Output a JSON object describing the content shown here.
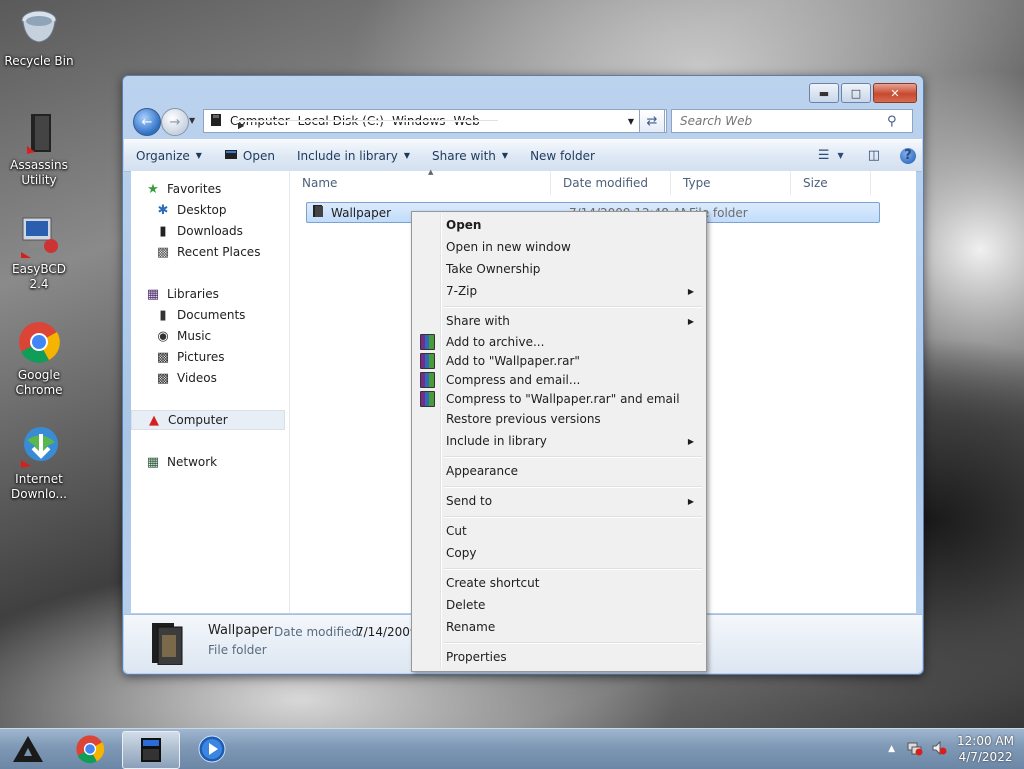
{
  "desktop": {
    "icons": [
      {
        "label": "Recycle Bin"
      },
      {
        "label": "Assassins Utility"
      },
      {
        "label": "EasyBCD 2.4"
      },
      {
        "label": "Google Chrome"
      },
      {
        "label": "Internet Downlo..."
      }
    ]
  },
  "window": {
    "address": {
      "crumbs": [
        "Computer",
        "Local Disk (C:)",
        "Windows",
        "Web"
      ]
    },
    "search": {
      "placeholder": "Search Web"
    },
    "toolbar": {
      "organize": "Organize",
      "open": "Open",
      "include_in_library": "Include in library",
      "share_with": "Share with",
      "new_folder": "New folder"
    },
    "nav": {
      "favorites": "Favorites",
      "desktop": "Desktop",
      "downloads": "Downloads",
      "recent_places": "Recent Places",
      "libraries": "Libraries",
      "documents": "Documents",
      "music": "Music",
      "pictures": "Pictures",
      "videos": "Videos",
      "computer": "Computer",
      "network": "Network"
    },
    "columns": {
      "name": "Name",
      "date_modified": "Date modified",
      "type": "Type",
      "size": "Size"
    },
    "files": [
      {
        "name": "Wallpaper",
        "date": "7/14/2009 12:48 AM",
        "type": "File folder",
        "size": ""
      }
    ],
    "details": {
      "name": "Wallpaper",
      "date_label": "Date modified:",
      "date_value": "7/14/2009",
      "type": "File folder"
    }
  },
  "context_menu": {
    "open": "Open",
    "open_new_window": "Open in new window",
    "take_ownership": "Take Ownership",
    "seven_zip": "7-Zip",
    "share_with": "Share with",
    "add_to_archive": "Add to archive...",
    "add_to_rar": "Add to \"Wallpaper.rar\"",
    "compress_email": "Compress and email...",
    "compress_rar_email": "Compress to \"Wallpaper.rar\" and email",
    "restore_previous": "Restore previous versions",
    "include_in_library": "Include in library",
    "appearance": "Appearance",
    "send_to": "Send to",
    "cut": "Cut",
    "copy": "Copy",
    "create_shortcut": "Create shortcut",
    "delete": "Delete",
    "rename": "Rename",
    "properties": "Properties"
  },
  "taskbar": {
    "clock_time": "12:00 AM",
    "clock_date": "4/7/2022"
  }
}
